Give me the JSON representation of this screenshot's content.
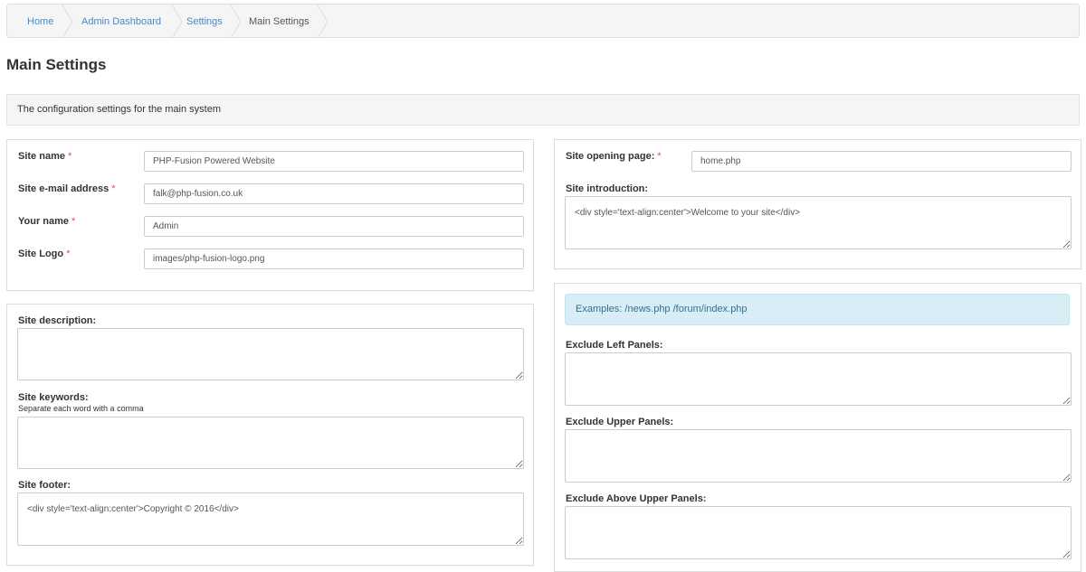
{
  "breadcrumb": {
    "items": [
      {
        "label": "Home"
      },
      {
        "label": "Admin Dashboard"
      },
      {
        "label": "Settings"
      },
      {
        "label": "Main Settings"
      }
    ]
  },
  "page": {
    "title": "Main Settings",
    "description": "The configuration settings for the main system"
  },
  "colors": {
    "link": "#428bca",
    "required": "#d9534f",
    "info_bg": "#d9edf7",
    "info_text": "#31708f"
  },
  "site_info": {
    "site_name": {
      "label": "Site name",
      "value": "PHP-Fusion Powered Website"
    },
    "site_email": {
      "label": "Site e-mail address",
      "value": "falk@php-fusion.co.uk"
    },
    "your_name": {
      "label": "Your name",
      "value": "Admin"
    },
    "site_logo": {
      "label": "Site Logo",
      "value": "images/php-fusion-logo.png"
    },
    "required_mark": "*"
  },
  "site_meta": {
    "description": {
      "label": "Site description:",
      "value": ""
    },
    "keywords": {
      "label": "Site keywords:",
      "hint": "Separate each word with a comma",
      "value": ""
    },
    "footer": {
      "label": "Site footer:",
      "value": "<div style='text-align:center'>Copyright © 2016</div>"
    }
  },
  "opening": {
    "opening_page": {
      "label": "Site opening page:",
      "value": "home.php"
    },
    "intro": {
      "label": "Site introduction:",
      "value": "<div style='text-align:center'>Welcome to your site</div>"
    }
  },
  "panels_exclude": {
    "examples": "Examples: /news.php /forum/index.php",
    "left": {
      "label": "Exclude Left Panels:",
      "value": ""
    },
    "upper": {
      "label": "Exclude Upper Panels:",
      "value": ""
    },
    "above_upper": {
      "label": "Exclude Above Upper Panels:",
      "value": ""
    }
  }
}
